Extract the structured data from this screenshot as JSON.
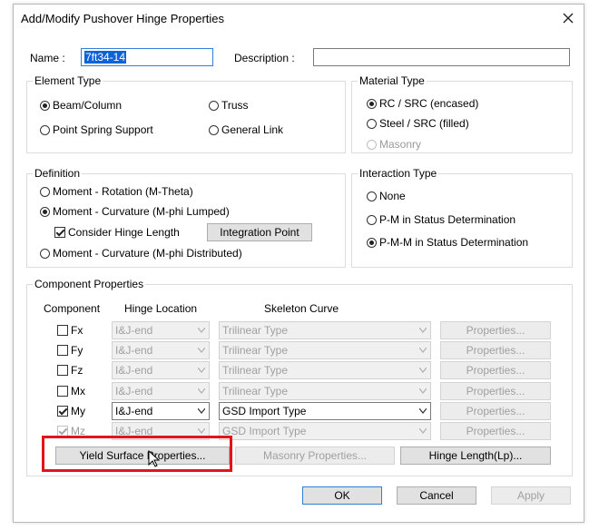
{
  "dialog": {
    "title": "Add/Modify Pushover Hinge Properties"
  },
  "name_field": {
    "label": "Name :",
    "value": "7ft34-14"
  },
  "description_field": {
    "label": "Description :",
    "value": ""
  },
  "element_type": {
    "title": "Element Type",
    "options": [
      "Beam/Column",
      "Truss",
      "Point Spring Support",
      "General Link"
    ],
    "selected": "Beam/Column"
  },
  "material_type": {
    "title": "Material Type",
    "options": [
      "RC / SRC (encased)",
      "Steel / SRC (filled)",
      "Masonry"
    ],
    "selected": "RC / SRC (encased)"
  },
  "definition": {
    "title": "Definition",
    "options": [
      "Moment - Rotation (M-Theta)",
      "Moment - Curvature (M-phi Lumped)",
      "Moment - Curvature (M-phi Distributed)"
    ],
    "selected": "Moment - Curvature (M-phi Lumped)",
    "consider_hinge_length": "Consider Hinge Length",
    "integration_point_button": "Integration Point"
  },
  "interaction_type": {
    "title": "Interaction Type",
    "options": [
      "None",
      "P-M in Status Determination",
      "P-M-M in Status Determination"
    ],
    "selected": "P-M-M in Status Determination"
  },
  "component_properties": {
    "title": "Component Properties",
    "headers": {
      "component": "Component",
      "hinge_location": "Hinge Location",
      "skeleton_curve": "Skeleton Curve"
    },
    "rows": [
      {
        "component": "Fx",
        "checked": false,
        "enabled": true,
        "location": "I&J-end",
        "curve": "Trilinear Type",
        "active": false,
        "props": "Properties..."
      },
      {
        "component": "Fy",
        "checked": false,
        "enabled": true,
        "location": "I&J-end",
        "curve": "Trilinear Type",
        "active": false,
        "props": "Properties..."
      },
      {
        "component": "Fz",
        "checked": false,
        "enabled": true,
        "location": "I&J-end",
        "curve": "Trilinear Type",
        "active": false,
        "props": "Properties..."
      },
      {
        "component": "Mx",
        "checked": false,
        "enabled": true,
        "location": "I&J-end",
        "curve": "Trilinear Type",
        "active": false,
        "props": "Properties..."
      },
      {
        "component": "My",
        "checked": true,
        "enabled": true,
        "location": "I&J-end",
        "curve": "GSD Import Type",
        "active": true,
        "props": "Properties..."
      },
      {
        "component": "Mz",
        "checked": true,
        "enabled": false,
        "location": "I&J-end",
        "curve": "GSD Import Type",
        "active": false,
        "props": "Properties..."
      }
    ],
    "yield_surface_button": "Yield Surface Properties...",
    "masonry_button": "Masonry Properties...",
    "hinge_length_button": "Hinge Length(Lp)..."
  },
  "footer": {
    "ok": "OK",
    "cancel": "Cancel",
    "apply": "Apply"
  },
  "colors": {
    "highlight": "#e3141c",
    "selection": "#0a64d8",
    "focus_border": "#2f7fd6"
  }
}
